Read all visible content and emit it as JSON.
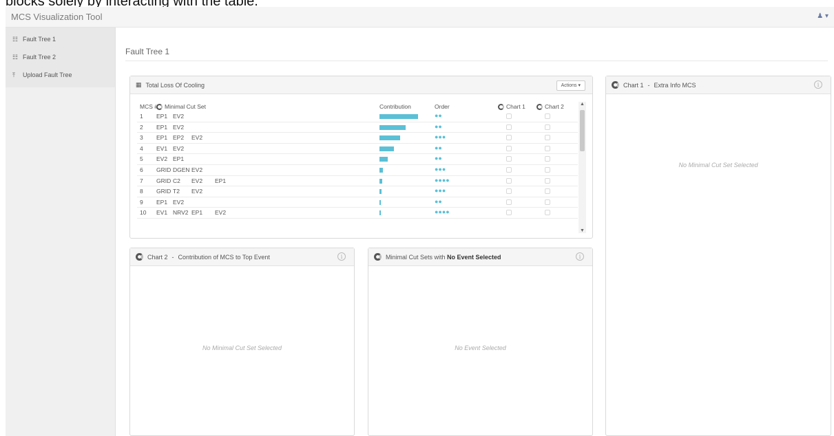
{
  "document_text": "blocks solely by interacting with the table.",
  "app": {
    "title": "MCS Visualization Tool",
    "user_icon": "user-icon",
    "caret": "▾"
  },
  "sidebar": {
    "items": [
      {
        "label": "Fault Tree 1",
        "icon": "sitemap-icon"
      },
      {
        "label": "Fault Tree 2",
        "icon": "sitemap-icon"
      },
      {
        "label": "Upload Fault Tree",
        "icon": "upload-icon"
      }
    ]
  },
  "page": {
    "title": "Fault Tree 1"
  },
  "main_panel": {
    "title": "Total Loss Of Cooling",
    "actions_label": "Actions ▾",
    "columns": {
      "mcs": "MCS #",
      "set": "Minimal Cut Set",
      "contribution": "Contribution",
      "order": "Order",
      "chart1": "Chart 1",
      "chart2": "Chart 2"
    },
    "rows": [
      {
        "num": "1",
        "events": [
          "EP1",
          "EV2",
          "",
          ""
        ],
        "contribution": 1.0,
        "order": "●●"
      },
      {
        "num": "2",
        "events": [
          "EP1",
          "EV2",
          "",
          ""
        ],
        "contribution": 0.68,
        "order": "●●"
      },
      {
        "num": "3",
        "events": [
          "EP1",
          "EP2",
          "EV2",
          ""
        ],
        "contribution": 0.53,
        "order": "●●●"
      },
      {
        "num": "4",
        "events": [
          "EV1",
          "EV2",
          "",
          ""
        ],
        "contribution": 0.38,
        "order": "●●"
      },
      {
        "num": "5",
        "events": [
          "EV2",
          "EP1",
          "",
          ""
        ],
        "contribution": 0.22,
        "order": "●●"
      },
      {
        "num": "6",
        "events": [
          "GRID",
          "DGEN",
          "EV2",
          ""
        ],
        "contribution": 0.09,
        "order": "●●●"
      },
      {
        "num": "7",
        "events": [
          "GRID",
          "C2",
          "EV2",
          "EP1"
        ],
        "contribution": 0.07,
        "order": "●●●●"
      },
      {
        "num": "8",
        "events": [
          "GRID",
          "T2",
          "EV2",
          ""
        ],
        "contribution": 0.05,
        "order": "●●●"
      },
      {
        "num": "9",
        "events": [
          "EP1",
          "EV2",
          "",
          ""
        ],
        "contribution": 0.03,
        "order": "●●"
      },
      {
        "num": "10",
        "events": [
          "EV1",
          "NRV2",
          "EP1",
          "EV2"
        ],
        "contribution": 0.02,
        "order": "●●●●"
      }
    ]
  },
  "chart1_panel": {
    "prefix": "Chart 1",
    "sep": "-",
    "title": "Extra Info MCS",
    "placeholder": "No Minimal Cut Set Selected"
  },
  "chart2_panel": {
    "prefix": "Chart 2",
    "sep": "-",
    "title": "Contribution of MCS to Top Event",
    "placeholder": "No Minimal Cut Set Selected"
  },
  "mcs_panel": {
    "title_prefix": "Minimal Cut Sets with ",
    "title_bold": "No Event Selected",
    "placeholder": "No Event Selected"
  },
  "colors": {
    "accent": "#5bc0d6"
  }
}
